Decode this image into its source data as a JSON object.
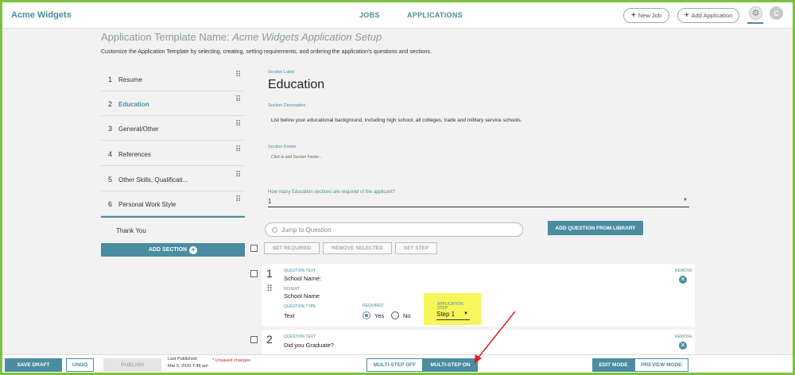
{
  "header": {
    "brand": "Acme Widgets",
    "tabs": [
      "JOBS",
      "APPLICATIONS"
    ],
    "new_job_label": "New Job",
    "add_application_label": "Add Application",
    "avatar_initial": "C"
  },
  "page": {
    "title_prefix": "Application Template Name:",
    "title_name": "Acme Widgets Application Setup",
    "subtitle": "Customize the Application Template by selecting, creating, setting requirements, and ordering the application's questions and sections."
  },
  "sidebar": {
    "items": [
      {
        "num": "1",
        "label": "Resume"
      },
      {
        "num": "2",
        "label": "Education"
      },
      {
        "num": "3",
        "label": "General/Other"
      },
      {
        "num": "4",
        "label": "References"
      },
      {
        "num": "5",
        "label": "Other Skills, Qualificati..."
      },
      {
        "num": "6",
        "label": "Personal Work Style"
      }
    ],
    "thank_you": "Thank You",
    "add_section_label": "ADD SECTION"
  },
  "section": {
    "label_caption": "Section Label",
    "label": "Education",
    "description_caption": "Section Description",
    "description": "List below your educational background, including high school, all colleges, trade and military service schools.",
    "footer_caption": "Section Footer",
    "footer_placeholder": "Click to add Section Footer...",
    "required_question": "How many Education sections are required of the applicant?",
    "required_value": "1"
  },
  "toolbar": {
    "jump_placeholder": "Jump to Question",
    "add_from_library": "ADD QUESTION FROM LIBRARY",
    "set_required": "SET REQUIRED",
    "remove_selected": "REMOVE SELECTED",
    "set_step": "SET STEP"
  },
  "questions": [
    {
      "num": "1",
      "text_caption": "QUESTION TEXT",
      "text": "School Name:",
      "insight_caption": "INSIGHT",
      "insight": "School Name",
      "type_caption": "QUESTION TYPE",
      "type": "Text",
      "required_caption": "REQUIRED",
      "yes_label": "Yes",
      "no_label": "No",
      "step_caption": "APPLICATION STEP",
      "step": "Step 1",
      "remove_label": "REMOVE"
    },
    {
      "num": "2",
      "text_caption": "QUESTION TEXT",
      "text": "Did you Graduate?",
      "remove_label": "REMOVE"
    }
  ],
  "footer": {
    "save_draft": "SAVE DRAFT",
    "undo": "UNDO",
    "publish": "PUBLISH",
    "last_published_label": "Last Published:",
    "last_published_date": "Mar 5, 2020 7:48 am",
    "unsaved": "* Unsaved changes",
    "multistep_off": "MULTI-STEP OFF",
    "multistep_on": "MULTI-STEP ON",
    "edit_mode": "EDIT MODE",
    "preview_mode": "PREVIEW MODE"
  },
  "colors": {
    "accent": "#4a8ca0",
    "frame": "#7cc242",
    "highlight": "#f6f55a",
    "annotation_arrow": "#e02020",
    "unsaved": "#e02020"
  }
}
